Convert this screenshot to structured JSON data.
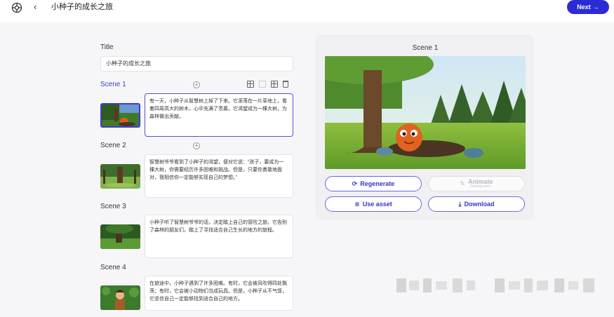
{
  "header": {
    "back_icon": "chevron-left-icon",
    "app_title": "小种子的成长之旅",
    "next_label": "Next",
    "next_arrow": "→",
    "accent": "#2b2bd6"
  },
  "title_field": {
    "label": "Title",
    "value": "小种子的成长之旅"
  },
  "scenes": [
    {
      "label": "Scene 1",
      "text": "有一天，小种子从智慧树上掉了下来。它滚落在一片草地上，看着四周高大的树木，心中充满了羡慕。它渴望成为一棵大树，为森林做出贡献。"
    },
    {
      "label": "Scene 2",
      "text": "智慧树爷爷看到了小种子的渴望，便对它说：“孩子，要成为一棵大树，你需要经历许多困难和挑战。但是，只要你勇敢地面对，我相信你一定能够实现自己的梦想。”"
    },
    {
      "label": "Scene 3",
      "text": "小种子听了智慧树爷爷的话，决定踏上自己的冒险之旅。它告别了森林的朋友们，踏上了寻找适合自己生长的地方的旅程。"
    },
    {
      "label": "Scene 4",
      "text": "在旅途中，小种子遇到了许多困难。有时，它会被风吹得四处飘荡；有时，它会被小动物们当成玩具。但是，小种子从不气馁，它坚信自己一定能够找到适合自己的地方。"
    }
  ],
  "preview": {
    "title": "Scene 1",
    "regenerate_label": "Regenerate",
    "animate_label": "Animate",
    "animate_sub": "Coming soon",
    "use_asset_label": "Use asset",
    "download_label": "Download"
  }
}
